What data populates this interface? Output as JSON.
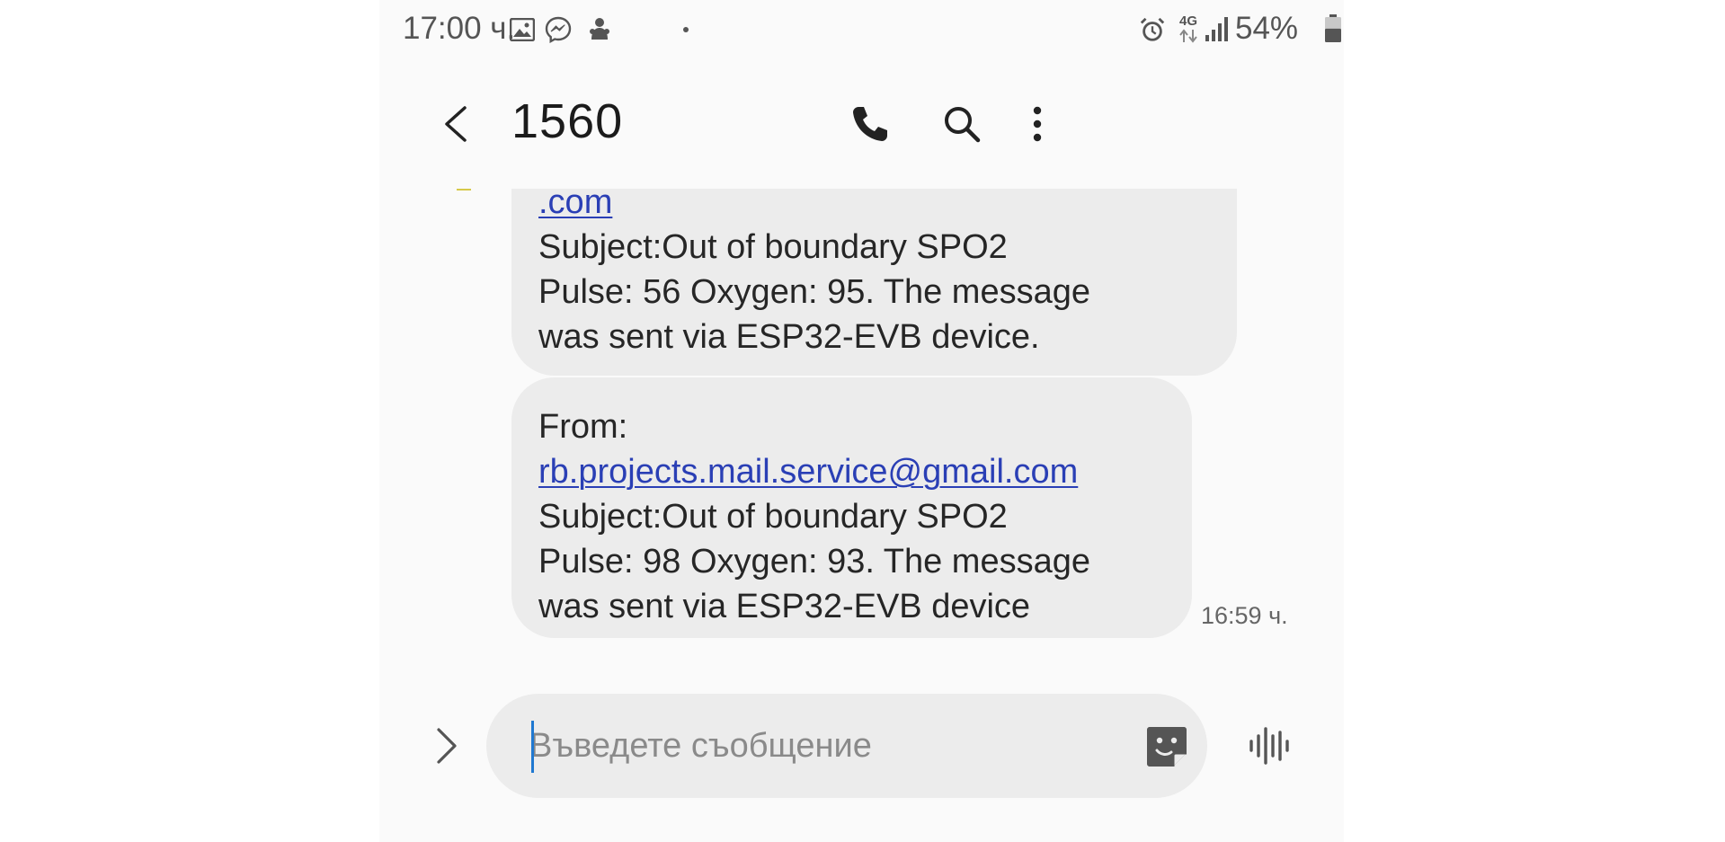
{
  "status_bar": {
    "time": "17:00 ч.",
    "network": "4G",
    "battery_percent": "54%",
    "battery_level": 0.54,
    "icons": [
      "image-icon",
      "messenger-icon",
      "app-notification-icon",
      "alarm-icon",
      "signal-icon",
      "battery-icon"
    ]
  },
  "header": {
    "title": "1560",
    "icons": [
      "back-arrow-icon",
      "phone-icon",
      "search-icon",
      "more-vertical-icon"
    ]
  },
  "messages": [
    {
      "lines": [
        {
          "text": ".com",
          "link": true
        },
        {
          "text": "Subject:Out of boundary SPO2",
          "link": false
        },
        {
          "text": "Pulse: 56 Oxygen: 95. The message",
          "link": false
        },
        {
          "text": "was sent via ESP32-EVB device.",
          "link": false
        }
      ]
    },
    {
      "lines": [
        {
          "text": "From:",
          "link": false
        },
        {
          "text": "rb.projects.mail.service@gmail.com",
          "link": true
        },
        {
          "text": "Subject:Out of boundary SPO2",
          "link": false
        },
        {
          "text": "Pulse: 98 Oxygen: 93. The message",
          "link": false
        },
        {
          "text": "was sent via ESP32-EVB device",
          "link": false
        }
      ],
      "timestamp": "16:59 ч."
    }
  ],
  "composer": {
    "placeholder": "Въведете съобщение",
    "icons": [
      "expand-arrow-icon",
      "sticker-icon",
      "voice-input-icon"
    ]
  },
  "colors": {
    "bubble": "#ececec",
    "link": "#2a3fb5",
    "caret": "#1f78d1",
    "background": "#fafafa"
  }
}
